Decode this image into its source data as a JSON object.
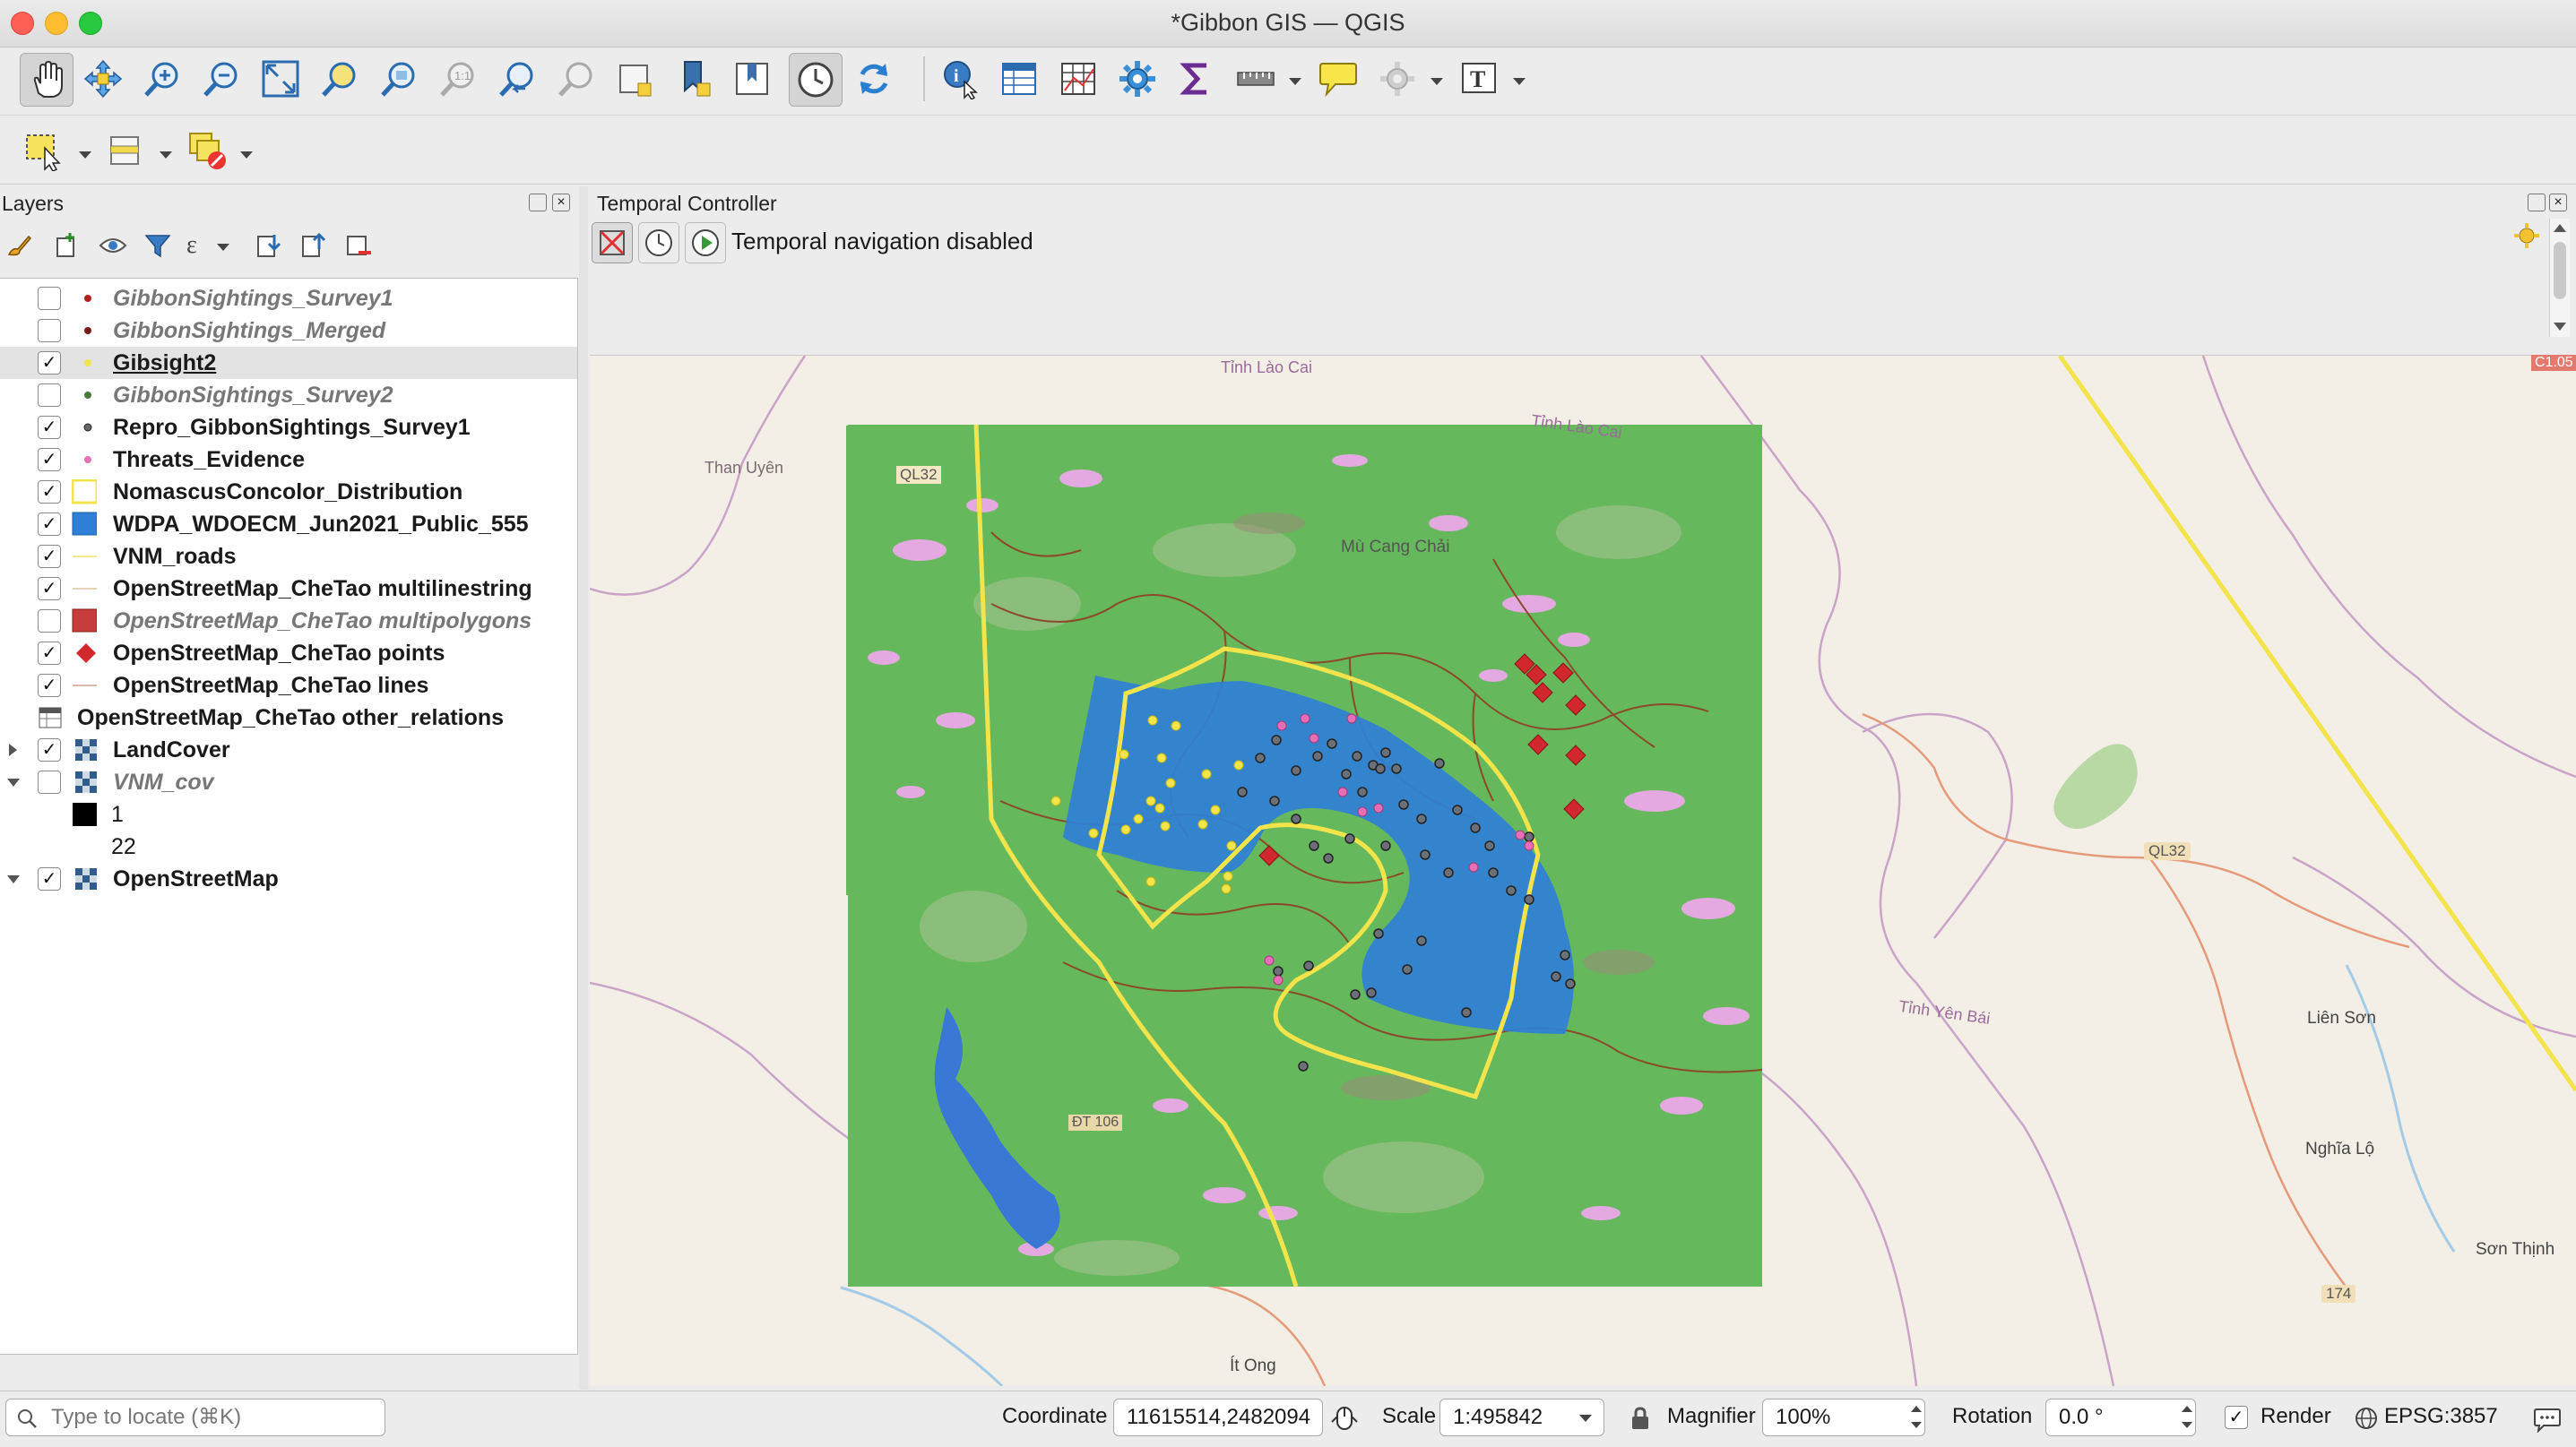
{
  "window": {
    "title": "*Gibbon GIS — QGIS"
  },
  "layers_panel": {
    "title": "Layers",
    "items": [
      {
        "name": "GibbonSightings_Survey1",
        "checked": false,
        "style": "italic"
      },
      {
        "name": "GibbonSightings_Merged",
        "checked": false,
        "style": "italic"
      },
      {
        "name": "Gibsight2",
        "checked": true,
        "style": "underline"
      },
      {
        "name": "GibbonSightings_Survey2",
        "checked": false,
        "style": "italic"
      },
      {
        "name": "Repro_GibbonSightings_Survey1",
        "checked": true,
        "style": "bold"
      },
      {
        "name": "Threats_Evidence",
        "checked": true,
        "style": "bold"
      },
      {
        "name": "NomascusConcolor_Distribution",
        "checked": true,
        "style": "bold"
      },
      {
        "name": "WDPA_WDOECM_Jun2021_Public_555",
        "checked": true,
        "style": "bold"
      },
      {
        "name": "VNM_roads",
        "checked": true,
        "style": "bold"
      },
      {
        "name": "OpenStreetMap_CheTao multilinestring",
        "checked": true,
        "style": "bold"
      },
      {
        "name": "OpenStreetMap_CheTao multipolygons",
        "checked": false,
        "style": "italic"
      },
      {
        "name": "OpenStreetMap_CheTao points",
        "checked": true,
        "style": "bold"
      },
      {
        "name": "OpenStreetMap_CheTao lines",
        "checked": true,
        "style": "bold"
      },
      {
        "name": "OpenStreetMap_CheTao other_relations",
        "checked": null,
        "style": "bold"
      },
      {
        "name": "LandCover",
        "checked": true,
        "style": "bold"
      },
      {
        "name": "VNM_cov",
        "checked": false,
        "style": "italic"
      },
      {
        "name": "1",
        "checked": null,
        "style": "plain"
      },
      {
        "name": "22",
        "checked": null,
        "style": "plain"
      },
      {
        "name": "OpenStreetMap",
        "checked": true,
        "style": "bold"
      }
    ]
  },
  "temporal": {
    "title": "Temporal Controller",
    "status": "Temporal navigation disabled"
  },
  "map_labels": {
    "tinh_lao_cai_1": "Tỉnh Lào Cai",
    "tinh_lao_cai_2": "Tỉnh Lào Cai",
    "than_uyen": "Than Uyên",
    "ql32_left": "QL32",
    "mu_cang_chai": "Mù Cang Chải",
    "ql32_right": "QL32",
    "tinh_yen_bai": "Tỉnh Yên Bái",
    "lien_son": "Liên Sơn",
    "nghia_lo": "Nghĩa Lộ",
    "son_thinh": "Sơn Thịnh",
    "road_174": "174",
    "it_ong": "Ít Ong",
    "dt106": "ĐT 106",
    "c105": "C1.05"
  },
  "statusbar": {
    "locate_placeholder": "Type to locate (⌘K)",
    "coordinate_label": "Coordinate",
    "coordinate_value": "11615514,2482094",
    "scale_label": "Scale",
    "scale_value": "1:495842",
    "magnifier_label": "Magnifier",
    "magnifier_value": "100%",
    "rotation_label": "Rotation",
    "rotation_value": "0.0 °",
    "render_label": "Render",
    "crs": "EPSG:3857"
  },
  "colors": {
    "accent_blue": "#2f7fd6",
    "landcover_green": "#66b85c",
    "distribution_yellow": "#f2e44a",
    "poi_red": "#d0282d"
  }
}
